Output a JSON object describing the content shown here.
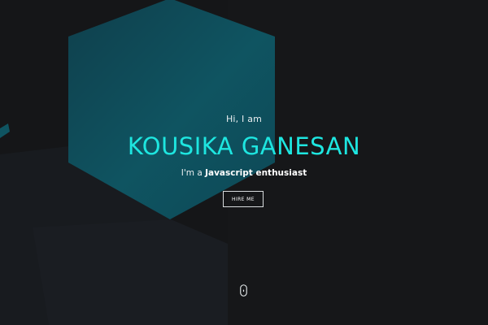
{
  "hero": {
    "greeting": "Hi, I am",
    "name": "KOUSIKA GANESAN",
    "tagline_prefix": "I'm a ",
    "tagline_highlight": "Javascript enthusiast",
    "hire_button_label": "HIRE ME"
  },
  "icons": {
    "scroll_indicator": "mouse-scroll-icon"
  },
  "colors": {
    "background": "#151618",
    "accent": "#1ee6e0",
    "hexagon": "#0f5461",
    "text": "#e9eef0"
  }
}
